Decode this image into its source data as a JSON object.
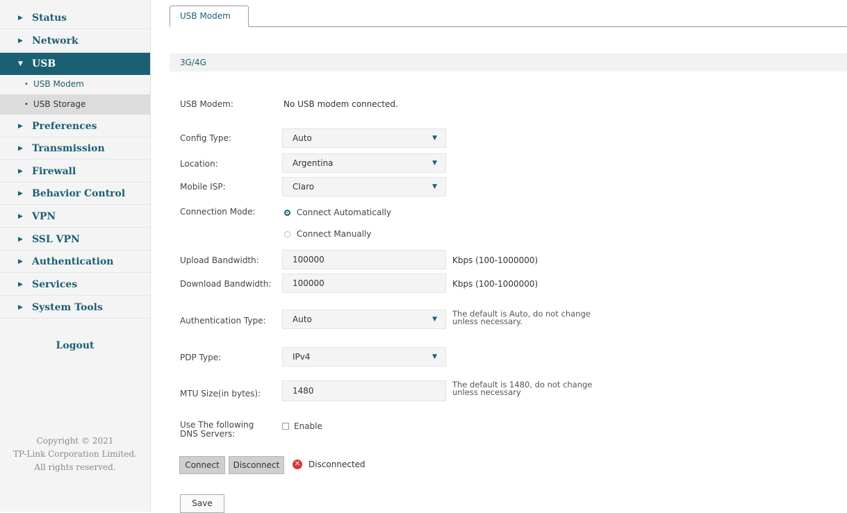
{
  "sidebar": {
    "items": [
      {
        "label": "Status"
      },
      {
        "label": "Network"
      },
      {
        "label": "USB"
      },
      {
        "label": "Preferences"
      },
      {
        "label": "Transmission"
      },
      {
        "label": "Firewall"
      },
      {
        "label": "Behavior Control"
      },
      {
        "label": "VPN"
      },
      {
        "label": "SSL VPN"
      },
      {
        "label": "Authentication"
      },
      {
        "label": "Services"
      },
      {
        "label": "System Tools"
      }
    ],
    "usb_subitems": [
      {
        "label": "USB Modem"
      },
      {
        "label": "USB Storage"
      }
    ],
    "logout": "Logout",
    "copyright": [
      "Copyright © 2021",
      "TP-Link Corporation Limited.",
      "All rights reserved."
    ]
  },
  "tab": {
    "label": "USB Modem"
  },
  "section": {
    "title": "3G/4G"
  },
  "form": {
    "usb_modem_label": "USB Modem:",
    "usb_modem_value": "No USB modem connected.",
    "config_type_label": "Config Type:",
    "config_type_value": "Auto",
    "location_label": "Location:",
    "location_value": "Argentina",
    "mobile_isp_label": "Mobile ISP:",
    "mobile_isp_value": "Claro",
    "connection_mode_label": "Connection Mode:",
    "connect_auto": "Connect Automatically",
    "connect_manual": "Connect Manually",
    "upload_label": "Upload Bandwidth:",
    "upload_value": "100000",
    "upload_unit": "Kbps (100-1000000)",
    "download_label": "Download Bandwidth:",
    "download_value": "100000",
    "download_unit": "Kbps (100-1000000)",
    "auth_type_label": "Authentication Type:",
    "auth_type_value": "Auto",
    "auth_hint_1": "The default is Auto, do not change",
    "auth_hint_2": "unless necessary.",
    "pdp_label": "PDP Type:",
    "pdp_value": "IPv4",
    "mtu_label": "MTU Size(in bytes):",
    "mtu_value": "1480",
    "mtu_hint_1": "The default is 1480, do not change",
    "mtu_hint_2": "unless necessary",
    "dns_label_1": "Use The following",
    "dns_label_2": "DNS Servers:",
    "dns_enable": "Enable"
  },
  "actions": {
    "connect": "Connect",
    "disconnect": "Disconnect",
    "status": "Disconnected",
    "save": "Save"
  },
  "colors": {
    "accent": "#1a5f73",
    "error": "#d9383a"
  }
}
